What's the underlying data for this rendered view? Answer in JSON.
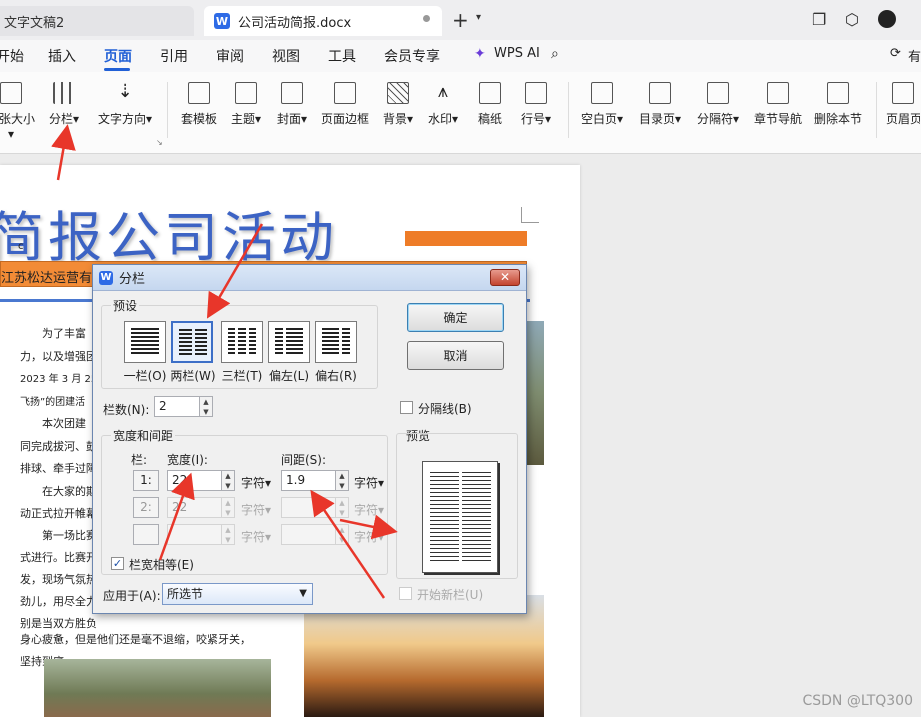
{
  "tabs": {
    "inactive": "文字文稿2",
    "active": "公司活动简报.docx",
    "app_letter": "W"
  },
  "menu": {
    "items": [
      "开始",
      "插入",
      "页面",
      "引用",
      "审阅",
      "视图",
      "工具",
      "会员专享"
    ],
    "active": "页面",
    "wps_ai": "WPS AI",
    "right_label": "有"
  },
  "ribbon": {
    "left": [
      "纸张大小▾",
      "分栏▾",
      "文字方向▾"
    ],
    "middle": [
      "套模板",
      "主题▾",
      "封面▾",
      "页面边框",
      "背景▾",
      "水印▾",
      "稿纸",
      "行号▾"
    ],
    "right": [
      "空白页▾",
      "目录页▾",
      "分隔符▾",
      "章节导航",
      "删除本节",
      "页眉页"
    ]
  },
  "document": {
    "title": "简报公司活动",
    "company_band": "江苏松达运营有限",
    "paragraphs": [
      "为了丰富",
      "力，以及增强团",
      "2023 年 3 月 25",
      "飞扬”的团建活",
      "本次团建",
      "同完成拔河、鼓",
      "排球、牵手过障",
      "在大家的期",
      "动正式拉开帷幕",
      "第一场比赛",
      "式进行。比赛开",
      "发，现场气氛热",
      "劲儿，用尽全力",
      "别是当双方胜负",
      "身心疲惫，但是他们还是毫不退缩，咬紧牙关，",
      "坚持到底。"
    ],
    "small_marker": "c"
  },
  "dialog": {
    "title": "分栏",
    "presets_label": "预设",
    "presets": [
      "一栏(O)",
      "两栏(W)",
      "三栏(T)",
      "偏左(L)",
      "偏右(R)"
    ],
    "selected_preset": "两栏(W)",
    "ok": "确定",
    "cancel": "取消",
    "column_count_label": "栏数(N):",
    "column_count": "2",
    "separator_label": "分隔线(B)",
    "separator_checked": false,
    "width_spacing_label": "宽度和间距",
    "col_header": "栏:",
    "width_header": "宽度(I):",
    "spacing_header": "间距(S):",
    "rows": [
      {
        "index": "1:",
        "width": "22",
        "spacing": "1.9",
        "unit": "字符▾",
        "enabled": true
      },
      {
        "index": "2:",
        "width": "22",
        "spacing": "",
        "unit": "字符▾",
        "enabled": false
      },
      {
        "index": "",
        "width": "",
        "spacing": "",
        "unit": "字符▾",
        "enabled": false
      }
    ],
    "equal_width_label": "栏宽相等(E)",
    "equal_width_checked": true,
    "preview_label": "预览",
    "apply_label": "应用于(A):",
    "apply_value": "所选节",
    "new_column_label": "开始新栏(U)",
    "new_column_checked": false
  },
  "watermark": "CSDN @LTQ300",
  "colors": {
    "accent": "#2160d6",
    "title_blue": "#3c63c4",
    "orange": "#ee7c28",
    "arrow_red": "#e8362a"
  }
}
